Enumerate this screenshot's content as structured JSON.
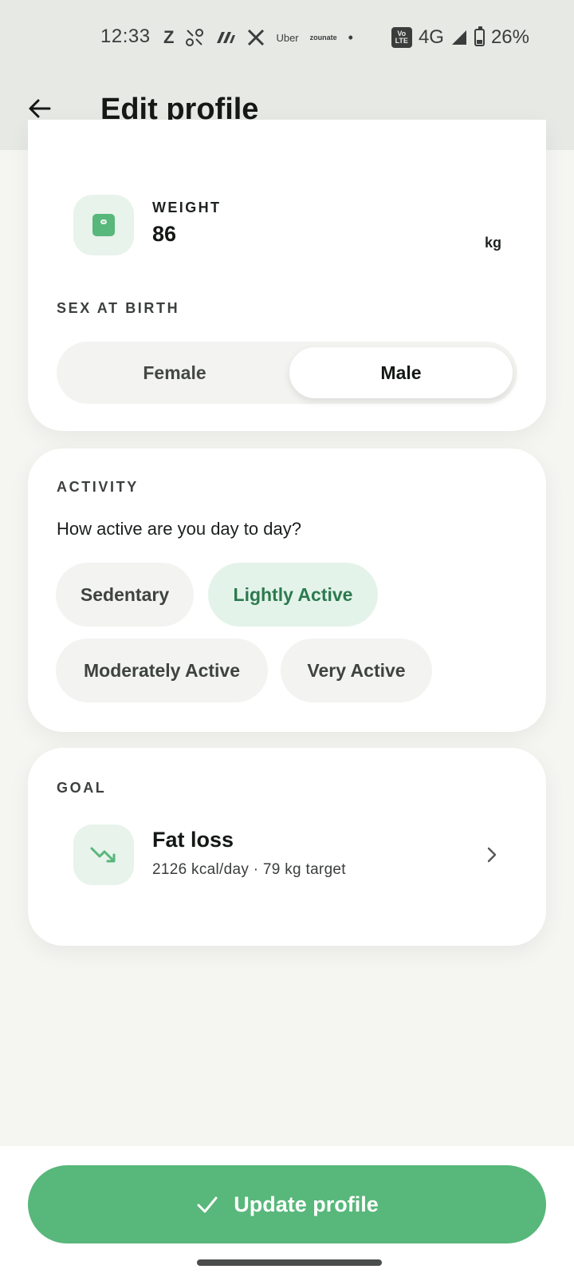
{
  "status_bar": {
    "time": "12:33",
    "app_icons": [
      "Z",
      "Uber",
      "zounate",
      "•"
    ],
    "network": "4G",
    "volte": "Vo\nLTE",
    "battery": "26%"
  },
  "header": {
    "title": "Edit profile"
  },
  "body_card": {
    "weight_label": "WEIGHT",
    "weight_value": "86",
    "weight_unit": "kg"
  },
  "sex": {
    "label": "SEX AT BIRTH",
    "options": [
      "Female",
      "Male"
    ],
    "selected": "Male"
  },
  "activity": {
    "label": "ACTIVITY",
    "question": "How active are you day to day?",
    "options": [
      "Sedentary",
      "Lightly Active",
      "Moderately Active",
      "Very Active"
    ],
    "selected": "Lightly Active"
  },
  "goal": {
    "label": "GOAL",
    "title": "Fat loss",
    "subtitle": "2126 kcal/day · 79 kg target"
  },
  "footer": {
    "update_label": "Update profile"
  },
  "colors": {
    "accent": "#58b77a",
    "accent_dark": "#2c7a4e",
    "tile_bg": "#e8f3ec"
  },
  "icons": {
    "back": "arrow-left",
    "weight": "scale",
    "goal": "trend-down",
    "chevron": "chevron-right",
    "check": "check"
  }
}
